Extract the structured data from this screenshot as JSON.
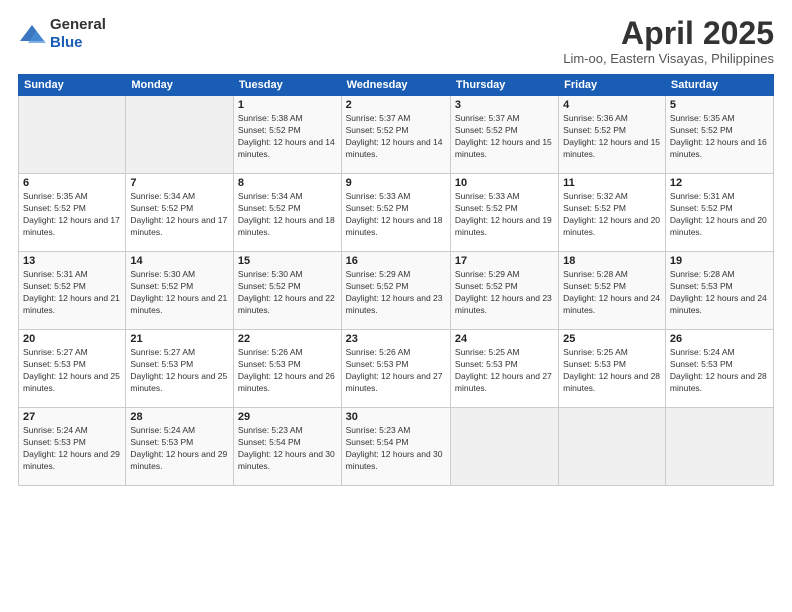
{
  "logo": {
    "general": "General",
    "blue": "Blue"
  },
  "header": {
    "title": "April 2025",
    "subtitle": "Lim-oo, Eastern Visayas, Philippines"
  },
  "weekdays": [
    "Sunday",
    "Monday",
    "Tuesday",
    "Wednesday",
    "Thursday",
    "Friday",
    "Saturday"
  ],
  "weeks": [
    [
      {
        "day": "",
        "sunrise": "",
        "sunset": "",
        "daylight": ""
      },
      {
        "day": "",
        "sunrise": "",
        "sunset": "",
        "daylight": ""
      },
      {
        "day": "1",
        "sunrise": "Sunrise: 5:38 AM",
        "sunset": "Sunset: 5:52 PM",
        "daylight": "Daylight: 12 hours and 14 minutes."
      },
      {
        "day": "2",
        "sunrise": "Sunrise: 5:37 AM",
        "sunset": "Sunset: 5:52 PM",
        "daylight": "Daylight: 12 hours and 14 minutes."
      },
      {
        "day": "3",
        "sunrise": "Sunrise: 5:37 AM",
        "sunset": "Sunset: 5:52 PM",
        "daylight": "Daylight: 12 hours and 15 minutes."
      },
      {
        "day": "4",
        "sunrise": "Sunrise: 5:36 AM",
        "sunset": "Sunset: 5:52 PM",
        "daylight": "Daylight: 12 hours and 15 minutes."
      },
      {
        "day": "5",
        "sunrise": "Sunrise: 5:35 AM",
        "sunset": "Sunset: 5:52 PM",
        "daylight": "Daylight: 12 hours and 16 minutes."
      }
    ],
    [
      {
        "day": "6",
        "sunrise": "Sunrise: 5:35 AM",
        "sunset": "Sunset: 5:52 PM",
        "daylight": "Daylight: 12 hours and 17 minutes."
      },
      {
        "day": "7",
        "sunrise": "Sunrise: 5:34 AM",
        "sunset": "Sunset: 5:52 PM",
        "daylight": "Daylight: 12 hours and 17 minutes."
      },
      {
        "day": "8",
        "sunrise": "Sunrise: 5:34 AM",
        "sunset": "Sunset: 5:52 PM",
        "daylight": "Daylight: 12 hours and 18 minutes."
      },
      {
        "day": "9",
        "sunrise": "Sunrise: 5:33 AM",
        "sunset": "Sunset: 5:52 PM",
        "daylight": "Daylight: 12 hours and 18 minutes."
      },
      {
        "day": "10",
        "sunrise": "Sunrise: 5:33 AM",
        "sunset": "Sunset: 5:52 PM",
        "daylight": "Daylight: 12 hours and 19 minutes."
      },
      {
        "day": "11",
        "sunrise": "Sunrise: 5:32 AM",
        "sunset": "Sunset: 5:52 PM",
        "daylight": "Daylight: 12 hours and 20 minutes."
      },
      {
        "day": "12",
        "sunrise": "Sunrise: 5:31 AM",
        "sunset": "Sunset: 5:52 PM",
        "daylight": "Daylight: 12 hours and 20 minutes."
      }
    ],
    [
      {
        "day": "13",
        "sunrise": "Sunrise: 5:31 AM",
        "sunset": "Sunset: 5:52 PM",
        "daylight": "Daylight: 12 hours and 21 minutes."
      },
      {
        "day": "14",
        "sunrise": "Sunrise: 5:30 AM",
        "sunset": "Sunset: 5:52 PM",
        "daylight": "Daylight: 12 hours and 21 minutes."
      },
      {
        "day": "15",
        "sunrise": "Sunrise: 5:30 AM",
        "sunset": "Sunset: 5:52 PM",
        "daylight": "Daylight: 12 hours and 22 minutes."
      },
      {
        "day": "16",
        "sunrise": "Sunrise: 5:29 AM",
        "sunset": "Sunset: 5:52 PM",
        "daylight": "Daylight: 12 hours and 23 minutes."
      },
      {
        "day": "17",
        "sunrise": "Sunrise: 5:29 AM",
        "sunset": "Sunset: 5:52 PM",
        "daylight": "Daylight: 12 hours and 23 minutes."
      },
      {
        "day": "18",
        "sunrise": "Sunrise: 5:28 AM",
        "sunset": "Sunset: 5:52 PM",
        "daylight": "Daylight: 12 hours and 24 minutes."
      },
      {
        "day": "19",
        "sunrise": "Sunrise: 5:28 AM",
        "sunset": "Sunset: 5:53 PM",
        "daylight": "Daylight: 12 hours and 24 minutes."
      }
    ],
    [
      {
        "day": "20",
        "sunrise": "Sunrise: 5:27 AM",
        "sunset": "Sunset: 5:53 PM",
        "daylight": "Daylight: 12 hours and 25 minutes."
      },
      {
        "day": "21",
        "sunrise": "Sunrise: 5:27 AM",
        "sunset": "Sunset: 5:53 PM",
        "daylight": "Daylight: 12 hours and 25 minutes."
      },
      {
        "day": "22",
        "sunrise": "Sunrise: 5:26 AM",
        "sunset": "Sunset: 5:53 PM",
        "daylight": "Daylight: 12 hours and 26 minutes."
      },
      {
        "day": "23",
        "sunrise": "Sunrise: 5:26 AM",
        "sunset": "Sunset: 5:53 PM",
        "daylight": "Daylight: 12 hours and 27 minutes."
      },
      {
        "day": "24",
        "sunrise": "Sunrise: 5:25 AM",
        "sunset": "Sunset: 5:53 PM",
        "daylight": "Daylight: 12 hours and 27 minutes."
      },
      {
        "day": "25",
        "sunrise": "Sunrise: 5:25 AM",
        "sunset": "Sunset: 5:53 PM",
        "daylight": "Daylight: 12 hours and 28 minutes."
      },
      {
        "day": "26",
        "sunrise": "Sunrise: 5:24 AM",
        "sunset": "Sunset: 5:53 PM",
        "daylight": "Daylight: 12 hours and 28 minutes."
      }
    ],
    [
      {
        "day": "27",
        "sunrise": "Sunrise: 5:24 AM",
        "sunset": "Sunset: 5:53 PM",
        "daylight": "Daylight: 12 hours and 29 minutes."
      },
      {
        "day": "28",
        "sunrise": "Sunrise: 5:24 AM",
        "sunset": "Sunset: 5:53 PM",
        "daylight": "Daylight: 12 hours and 29 minutes."
      },
      {
        "day": "29",
        "sunrise": "Sunrise: 5:23 AM",
        "sunset": "Sunset: 5:54 PM",
        "daylight": "Daylight: 12 hours and 30 minutes."
      },
      {
        "day": "30",
        "sunrise": "Sunrise: 5:23 AM",
        "sunset": "Sunset: 5:54 PM",
        "daylight": "Daylight: 12 hours and 30 minutes."
      },
      {
        "day": "",
        "sunrise": "",
        "sunset": "",
        "daylight": ""
      },
      {
        "day": "",
        "sunrise": "",
        "sunset": "",
        "daylight": ""
      },
      {
        "day": "",
        "sunrise": "",
        "sunset": "",
        "daylight": ""
      }
    ]
  ]
}
